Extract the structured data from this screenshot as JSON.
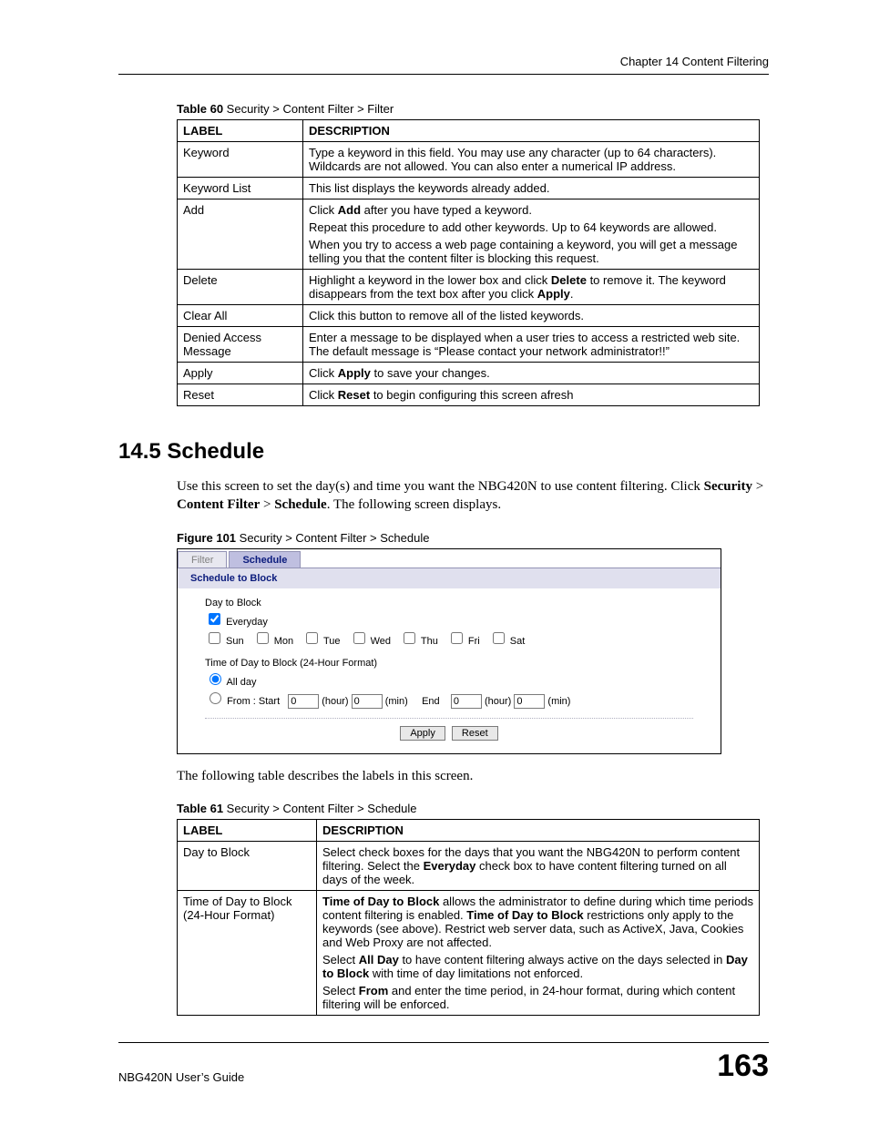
{
  "header": {
    "chapter_label": "Chapter 14 Content Filtering"
  },
  "table60": {
    "caption_prefix": "Table 60",
    "caption_rest": "   Security > Content Filter > Filter",
    "head_label": "LABEL",
    "head_desc": "DESCRIPTION",
    "rows": [
      {
        "label": "Keyword",
        "paras": [
          "Type a keyword in this field. You may use any character (up to 64 characters). Wildcards are not allowed. You can also enter a numerical IP address."
        ]
      },
      {
        "label": "Keyword List",
        "paras": [
          "This list displays the keywords already added."
        ]
      },
      {
        "label": "Add",
        "paras": [
          "Click <b>Add</b> after you have typed a keyword.",
          "Repeat this procedure to add other keywords. Up to 64 keywords are allowed.",
          "When you try to access a web page containing a keyword, you will get a message telling you that the content filter is blocking this request."
        ]
      },
      {
        "label": "Delete",
        "paras": [
          "Highlight a keyword in the lower box and click <b>Delete</b> to remove it. The keyword disappears from the text box after you click <b>Apply</b>."
        ]
      },
      {
        "label": "Clear All",
        "paras": [
          "Click this button to remove all of the listed keywords."
        ]
      },
      {
        "label": "Denied Access Message",
        "paras": [
          "Enter a message to be displayed when a user tries to access a restricted web site. The default message is “Please contact your network administrator!!”"
        ]
      },
      {
        "label": "Apply",
        "paras": [
          "Click <b>Apply</b> to save your changes."
        ]
      },
      {
        "label": "Reset",
        "paras": [
          "Click <b>Reset</b> to begin configuring this screen afresh"
        ]
      }
    ]
  },
  "section": {
    "heading": "14.5  Schedule",
    "intro_html": "Use this screen to set the day(s) and time you want the NBG420N to use content filtering. Click <b>Security</b> > <b>Content Filter</b> > <b>Schedule</b>. The following screen displays."
  },
  "figure101": {
    "caption_prefix": "Figure 101",
    "caption_rest": "   Security > Content Filter > Schedule",
    "tab_filter": "Filter",
    "tab_schedule": "Schedule",
    "subhead": "Schedule to Block",
    "day_label": "Day to Block",
    "everyday_label": "Everyday",
    "days": [
      "Sun",
      "Mon",
      "Tue",
      "Wed",
      "Thu",
      "Fri",
      "Sat"
    ],
    "time_label": "Time of Day to Block (24-Hour Format)",
    "allday_label": "All day",
    "from_label": "From :   Start",
    "hour_label": "(hour)",
    "min_label": "(min)",
    "end_label": "End",
    "start_hour": "0",
    "start_min": "0",
    "end_hour": "0",
    "end_min": "0",
    "apply_btn": "Apply",
    "reset_btn": "Reset"
  },
  "after_figure_text": "The following table describes the labels in this screen.",
  "table61": {
    "caption_prefix": "Table 61",
    "caption_rest": "   Security > Content Filter > Schedule",
    "head_label": "LABEL",
    "head_desc": "DESCRIPTION",
    "rows": [
      {
        "label": "Day to Block",
        "paras": [
          "Select check boxes for the days that you want the NBG420N to perform content filtering. Select the <b>Everyday</b> check box to have content filtering turned on all days of the week."
        ]
      },
      {
        "label": "Time of Day to Block (24-Hour Format)",
        "paras": [
          "<b>Time of Day to Block</b> allows the administrator to define during which time periods content filtering is enabled. <b>Time of Day to Block</b> restrictions only apply to the keywords (see above). Restrict web server data, such as ActiveX, Java, Cookies and Web Proxy are not affected.",
          "Select  <b>All Day</b> to have content filtering always active on the days selected in <b>Day to Block</b> with time of day limitations not enforced.",
          "Select <b>From</b> and enter the time period, in 24-hour format, during which content filtering will be enforced."
        ]
      }
    ]
  },
  "footer": {
    "guide": "NBG420N User’s Guide",
    "page": "163"
  }
}
